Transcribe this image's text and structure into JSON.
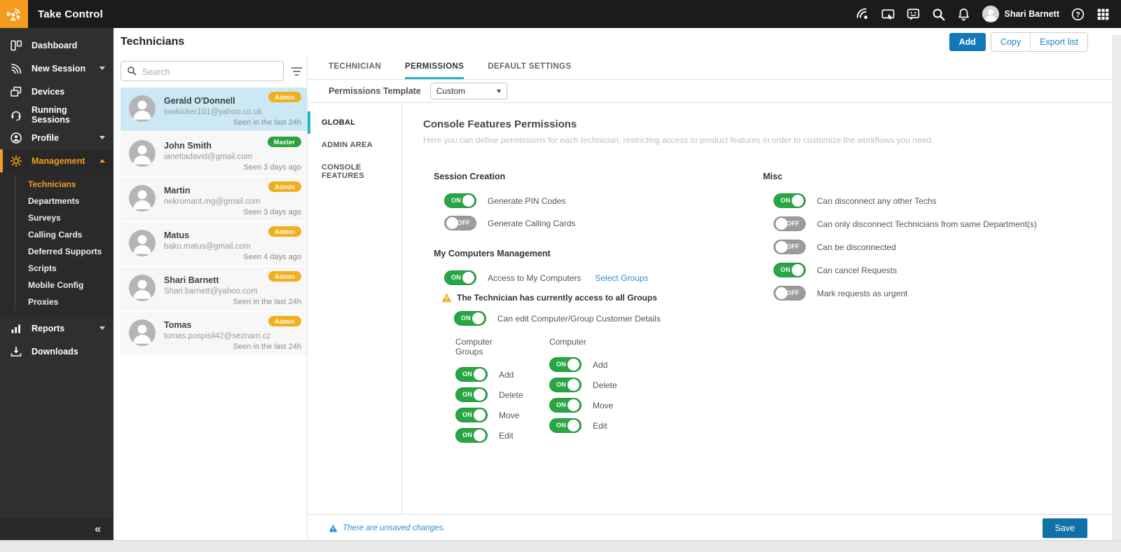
{
  "colors": {
    "topbar_bg": "#1b1b1b",
    "sidebar_bg": "#2f2f2f",
    "accent_orange": "#f39c1d",
    "accent_teal": "#2ab5c4",
    "accent_blue": "#1478b8",
    "link_blue": "#2e8fd0",
    "toggle_on": "#28a644",
    "toggle_off": "#9c9c9c",
    "badge_admin": "#f1af1c",
    "badge_master": "#2ca23c",
    "selected_row": "#cbe8f5"
  },
  "topbar": {
    "app_title": "Take Control",
    "user_name": "Shari Barnett"
  },
  "sidebar": {
    "items": [
      {
        "label": "Dashboard"
      },
      {
        "label": "New Session",
        "chevron": "down"
      },
      {
        "label": "Devices"
      },
      {
        "label": "Running Sessions"
      },
      {
        "label": "Profile",
        "chevron": "down"
      },
      {
        "label": "Management",
        "chevron": "up",
        "active": true
      }
    ],
    "management_children": [
      {
        "label": "Technicians",
        "active": true
      },
      {
        "label": "Departments"
      },
      {
        "label": "Surveys"
      },
      {
        "label": "Calling Cards"
      },
      {
        "label": "Deferred Supports"
      },
      {
        "label": "Scripts"
      },
      {
        "label": "Mobile Config"
      },
      {
        "label": "Proxies"
      }
    ],
    "items_bottom": [
      {
        "label": "Reports",
        "chevron": "down"
      },
      {
        "label": "Downloads"
      }
    ],
    "collapse_glyph": "«"
  },
  "header": {
    "title": "Technicians",
    "add_label": "Add",
    "copy_label": "Copy",
    "export_label": "Export list"
  },
  "list": {
    "search_placeholder": "Search",
    "technicians": [
      {
        "name": "Gerald O'Donnell",
        "email": "lowkicker101@yahoo.co.uk",
        "seen": "Seen in the last 24h",
        "badge": "Admin",
        "selected": true
      },
      {
        "name": "John Smith",
        "email": "ianettadavid@gmail.com",
        "seen": "Seen 3 days ago",
        "badge": "Master"
      },
      {
        "name": "Martin",
        "email": "nekromant.mg@gmail.com",
        "seen": "Seen 3 days ago",
        "badge": "Admin"
      },
      {
        "name": "Matus",
        "email": "bako.matus@gmail.com",
        "seen": "Seen 4 days ago",
        "badge": "Admin"
      },
      {
        "name": "Shari Barnett",
        "email": "Shari.barnett@yahoo.com",
        "seen": "Seen in the last 24h",
        "badge": "Admin"
      },
      {
        "name": "Tomas",
        "email": "tomas.pospisil42@seznam.cz",
        "seen": "Seen in the last 24h",
        "badge": "Admin"
      }
    ]
  },
  "main": {
    "tabs": [
      {
        "label": "TECHNICIAN"
      },
      {
        "label": "PERMISSIONS",
        "active": true
      },
      {
        "label": "DEFAULT SETTINGS"
      }
    ],
    "template_label": "Permissions Template",
    "template_value": "Custom",
    "subnav": [
      {
        "label": "GLOBAL",
        "active": true
      },
      {
        "label": "ADMIN AREA"
      },
      {
        "label": "CONSOLE FEATURES"
      }
    ],
    "content": {
      "title": "Console Features Permissions",
      "description": "Here you can define permissions for each technician, restricting access to product features in order to customize the workflows you need.",
      "session_creation": {
        "title": "Session Creation",
        "toggles": [
          {
            "label": "Generate PIN Codes",
            "state": "ON"
          },
          {
            "label": "Generate Calling Cards",
            "state": "OFF"
          }
        ]
      },
      "my_computers": {
        "title": "My Computers Management",
        "access_toggle": {
          "label": "Access to My Computers",
          "state": "ON"
        },
        "select_groups_link": "Select Groups",
        "warning": "The Technician has currently access to all Groups",
        "edit_toggle": {
          "label": "Can edit Computer/Group Customer Details",
          "state": "ON"
        },
        "groups_col": {
          "title": "Computer Groups",
          "toggles": [
            {
              "label": "Add",
              "state": "ON"
            },
            {
              "label": "Delete",
              "state": "ON"
            },
            {
              "label": "Move",
              "state": "ON"
            },
            {
              "label": "Edit",
              "state": "ON"
            }
          ]
        },
        "computer_col": {
          "title": "Computer",
          "toggles": [
            {
              "label": "Add",
              "state": "ON"
            },
            {
              "label": "Delete",
              "state": "ON"
            },
            {
              "label": "Move",
              "state": "ON"
            },
            {
              "label": "Edit",
              "state": "ON"
            }
          ]
        }
      },
      "misc": {
        "title": "Misc",
        "toggles": [
          {
            "label": "Can disconnect any other Techs",
            "state": "ON"
          },
          {
            "label": "Can only disconnect Technicians from same Department(s)",
            "state": "OFF"
          },
          {
            "label": "Can be disconnected",
            "state": "OFF"
          },
          {
            "label": "Can cancel Requests",
            "state": "ON"
          },
          {
            "label": "Mark requests as urgent",
            "state": "OFF"
          }
        ]
      }
    },
    "footer": {
      "unsaved": "There are unsaved changes.",
      "save_label": "Save"
    }
  }
}
